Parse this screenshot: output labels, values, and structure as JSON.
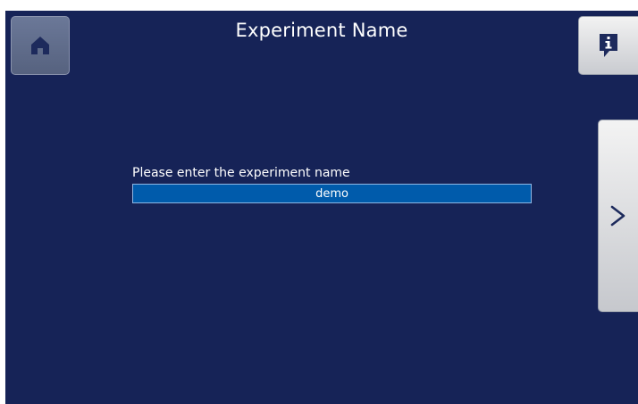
{
  "header": {
    "title": "Experiment Name",
    "home_icon": "home-icon",
    "info_icon": "info-icon"
  },
  "form": {
    "label": "Please enter the experiment name",
    "name_value": "demo"
  },
  "nav": {
    "next_label": ">"
  },
  "colors": {
    "background": "#162357",
    "input_fill": "#005bab",
    "button_light": "#e6e7ea",
    "home_button": "#606c8a"
  }
}
